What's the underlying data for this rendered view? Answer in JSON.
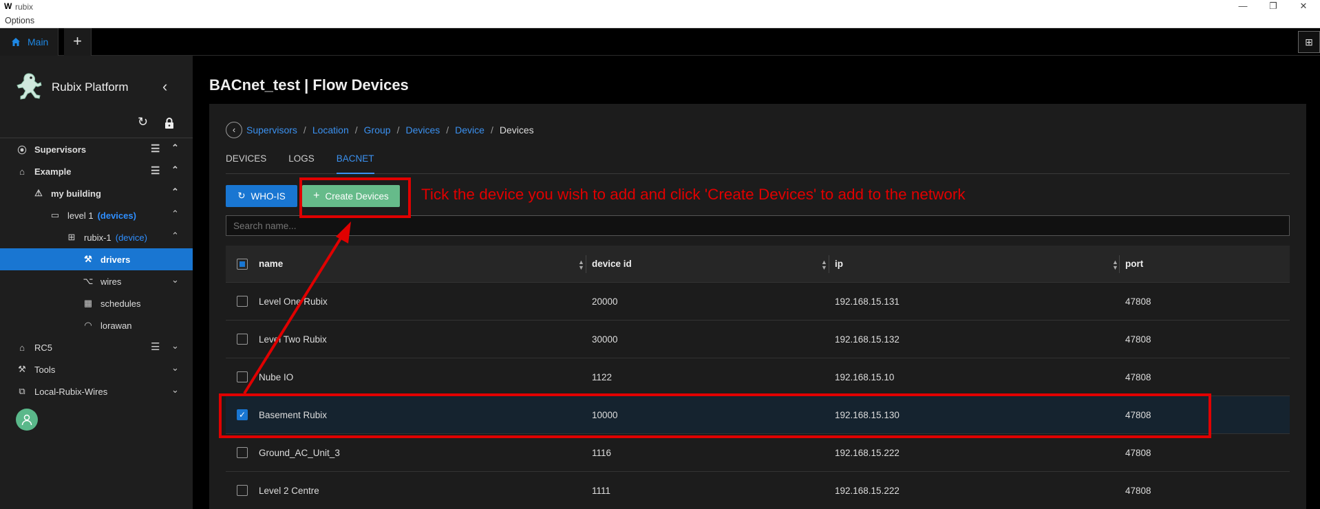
{
  "window": {
    "app_title": "rubix",
    "menu": "Options",
    "controls": [
      "—",
      "❐",
      "✕"
    ]
  },
  "tabbar": {
    "main_label": "Main",
    "add_label": "+",
    "right_icon": "split-view-icon"
  },
  "sidebar": {
    "title": "Rubix Platform",
    "items": [
      {
        "label": "Supervisors",
        "icon": "supervisor-icon",
        "tag": ""
      },
      {
        "label": "Example",
        "icon": "home-icon",
        "tag": ""
      },
      {
        "label": "my building",
        "icon": "warning-icon",
        "tag": ""
      },
      {
        "label": "level 1",
        "icon": "monitor-icon",
        "tag": "(devices)"
      },
      {
        "label": "rubix-1",
        "icon": "device-icon",
        "tag": "(device)"
      },
      {
        "label": "drivers",
        "icon": "wrench-icon",
        "tag": ""
      },
      {
        "label": "wires",
        "icon": "wires-icon",
        "tag": ""
      },
      {
        "label": "schedules",
        "icon": "calendar-icon",
        "tag": ""
      },
      {
        "label": "lorawan",
        "icon": "wifi-icon",
        "tag": ""
      },
      {
        "label": "RC5",
        "icon": "home-icon",
        "tag": ""
      },
      {
        "label": "Tools",
        "icon": "tools-icon",
        "tag": ""
      },
      {
        "label": "Local-Rubix-Wires",
        "icon": "network-icon",
        "tag": ""
      }
    ]
  },
  "main": {
    "page_title": "BACnet_test | Flow Devices",
    "breadcrumbs": [
      "Supervisors",
      "Location",
      "Group",
      "Devices",
      "Device"
    ],
    "breadcrumb_current": "Devices",
    "tabs": [
      "DEVICES",
      "LOGS",
      "BACNET"
    ],
    "active_tab": "BACNET",
    "who_is_label": "WHO-IS",
    "create_label": "Create Devices",
    "search_placeholder": "Search name...",
    "table": {
      "columns": [
        "name",
        "device id",
        "ip",
        "port"
      ],
      "rows": [
        {
          "name": "Level One Rubix",
          "device_id": "20000",
          "ip": "192.168.15.131",
          "port": "47808",
          "checked": false
        },
        {
          "name": "Level Two Rubix",
          "device_id": "30000",
          "ip": "192.168.15.132",
          "port": "47808",
          "checked": false
        },
        {
          "name": "Nube IO",
          "device_id": "1122",
          "ip": "192.168.15.10",
          "port": "47808",
          "checked": false
        },
        {
          "name": "Basement Rubix",
          "device_id": "10000",
          "ip": "192.168.15.130",
          "port": "47808",
          "checked": true
        },
        {
          "name": "Ground_AC_Unit_3",
          "device_id": "1116",
          "ip": "192.168.15.222",
          "port": "47808",
          "checked": false
        },
        {
          "name": "Level 2 Centre",
          "device_id": "1111",
          "ip": "192.168.15.222",
          "port": "47808",
          "checked": false
        }
      ]
    }
  },
  "annotation": {
    "text": "Tick the device you wish to add and click 'Create Devices' to add to the network",
    "color": "#e00000"
  },
  "colors": {
    "accent": "#1976d2",
    "create_button": "#66bb8a",
    "link": "#3b91f0"
  }
}
